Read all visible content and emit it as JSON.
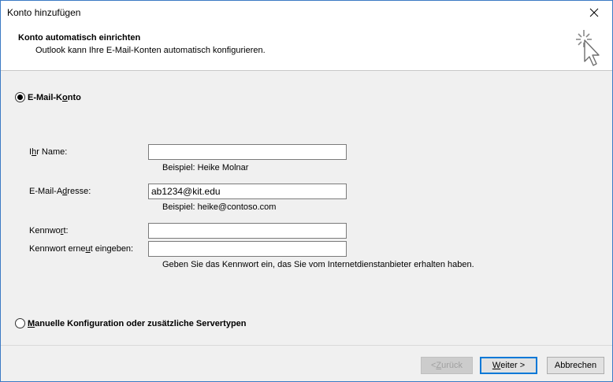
{
  "window": {
    "title": "Konto hinzufügen",
    "close_icon": "close-icon"
  },
  "header": {
    "title": "Konto automatisch einrichten",
    "subtitle": "Outlook kann Ihre E-Mail-Konten automatisch konfigurieren.",
    "icon": "cursor-click-icon"
  },
  "options": {
    "email_account": {
      "label_pre": "E-Mail-K",
      "label_u": "o",
      "label_post": "nto",
      "selected": true
    },
    "manual": {
      "label_pre": "",
      "label_u": "M",
      "label_post": "anuelle Konfiguration oder zusätzliche Servertypen",
      "selected": false
    }
  },
  "form": {
    "name": {
      "label_pre": "I",
      "label_u": "h",
      "label_post": "r Name:",
      "value": "",
      "hint": "Beispiel: Heike Molnar"
    },
    "email": {
      "label_pre": "E-Mail-A",
      "label_u": "d",
      "label_post": "resse:",
      "value": "ab1234@kit.edu",
      "hint": "Beispiel: heike@contoso.com"
    },
    "password": {
      "label_pre": "Kennwo",
      "label_u": "r",
      "label_post": "t:",
      "value": ""
    },
    "password_repeat": {
      "label_pre": "Kennwort erne",
      "label_u": "u",
      "label_post": "t eingeben:",
      "value": "",
      "hint": "Geben Sie das Kennwort ein, das Sie vom Internetdienstanbieter erhalten haben."
    }
  },
  "buttons": {
    "back": {
      "pre": "< ",
      "u": "Z",
      "post": "urück"
    },
    "next": {
      "pre": "",
      "u": "W",
      "post": "eiter >"
    },
    "cancel": "Abbrechen"
  }
}
